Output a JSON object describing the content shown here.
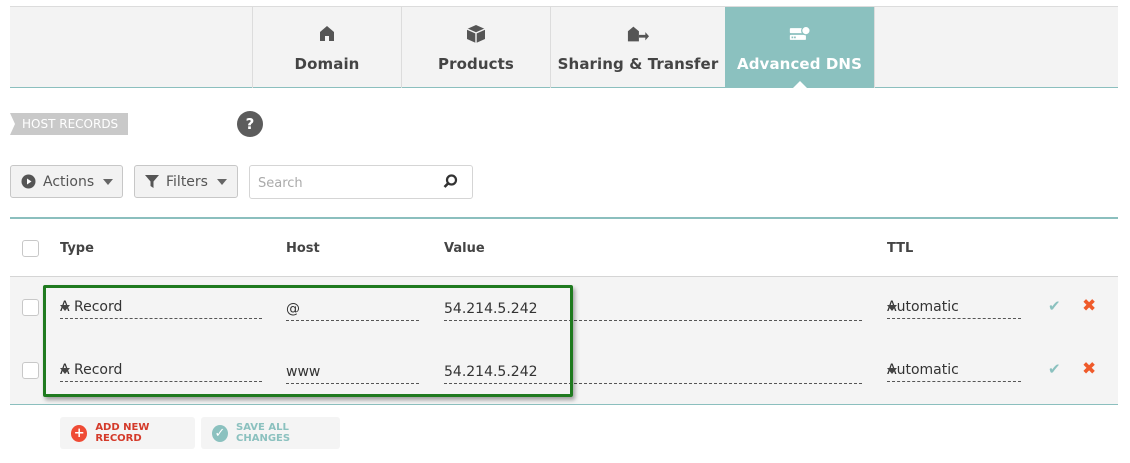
{
  "tabs": [
    {
      "label": "Domain",
      "icon": "home-icon"
    },
    {
      "label": "Products",
      "icon": "box-icon"
    },
    {
      "label": "Sharing & Transfer",
      "icon": "transfer-icon"
    },
    {
      "label": "Advanced DNS",
      "icon": "dns-server-icon",
      "active": true
    }
  ],
  "section": {
    "label": "HOST RECORDS",
    "help": "?"
  },
  "toolbar": {
    "actions_label": "Actions",
    "filters_label": "Filters",
    "search_placeholder": "Search"
  },
  "table": {
    "headers": {
      "type": "Type",
      "host": "Host",
      "value": "Value",
      "ttl": "TTL"
    },
    "rows": [
      {
        "type": "A Record",
        "host": "@",
        "value": "54.214.5.242",
        "ttl": "Automatic"
      },
      {
        "type": "A Record",
        "host": "www",
        "value": "54.214.5.242",
        "ttl": "Automatic"
      }
    ]
  },
  "footer": {
    "add_label": "ADD NEW RECORD",
    "save_label": "SAVE ALL CHANGES"
  },
  "colors": {
    "accent_teal": "#8bc1bf",
    "delete_orange": "#ef5a2a",
    "highlight_green": "#1f7a1f"
  }
}
